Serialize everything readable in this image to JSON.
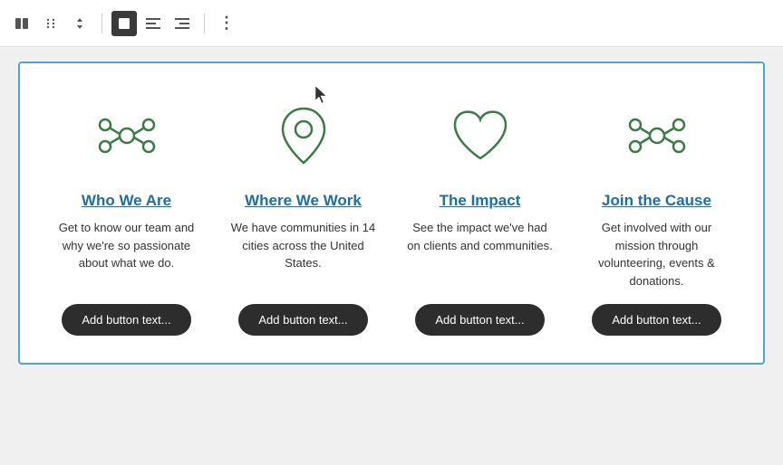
{
  "toolbar": {
    "buttons": [
      {
        "id": "columns-icon",
        "label": "⊞",
        "active": false
      },
      {
        "id": "drag-icon",
        "label": "⠿",
        "active": false
      },
      {
        "id": "arrows-icon",
        "label": "⬍",
        "active": false
      },
      {
        "id": "block-icon",
        "label": "■",
        "active": true
      },
      {
        "id": "align-left-icon",
        "label": "≡",
        "active": false
      },
      {
        "id": "align-right-icon",
        "label": "≡",
        "active": false
      },
      {
        "id": "more-icon",
        "label": "⋮",
        "active": false
      }
    ]
  },
  "cards": [
    {
      "id": "who-we-are",
      "icon": "network",
      "title": "Who We Are",
      "description": "Get to know our team and why we're so passionate about what we do.",
      "button_label": "Add button text..."
    },
    {
      "id": "where-we-work",
      "icon": "location",
      "title": "Where We Work",
      "description": "We have communities in 14 cities across the United States.",
      "button_label": "Add button text..."
    },
    {
      "id": "the-impact",
      "icon": "heart",
      "title": "The Impact",
      "description": "See the impact we've had on clients and communities.",
      "button_label": "Add button text..."
    },
    {
      "id": "join-the-cause",
      "icon": "network",
      "title": "Join the Cause",
      "description": "Get involved with our mission through volunteering, events & donations.",
      "button_label": "Add button text..."
    }
  ]
}
